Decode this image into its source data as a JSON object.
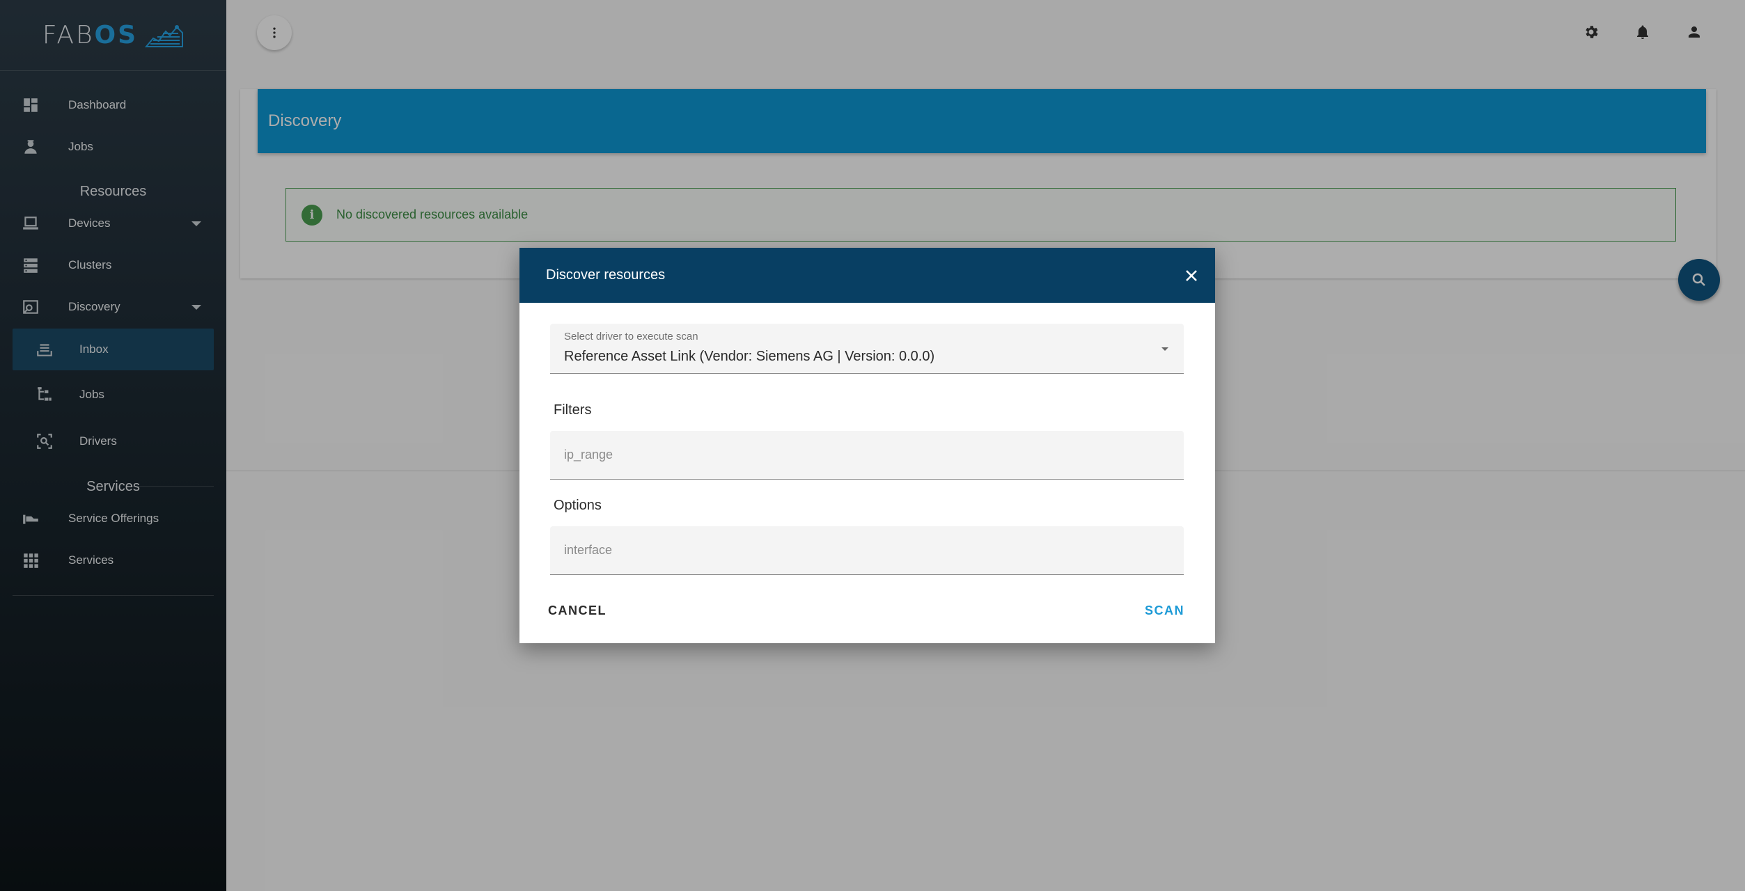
{
  "logo": {
    "part1": "FAB",
    "part2": "OS"
  },
  "sidebar": {
    "items": [
      {
        "label": "Dashboard",
        "icon": "dashboard-icon"
      },
      {
        "label": "Jobs",
        "icon": "worker-icon"
      }
    ],
    "resources_title": "Resources",
    "resources": [
      {
        "label": "Devices",
        "icon": "laptop-icon",
        "expandable": true
      },
      {
        "label": "Clusters",
        "icon": "server-stack-icon"
      },
      {
        "label": "Discovery",
        "icon": "discovery-icon",
        "expandable": true
      }
    ],
    "discovery_sub": [
      {
        "label": "Inbox",
        "icon": "inbox-icon",
        "active": true
      },
      {
        "label": "Jobs",
        "icon": "tree-icon"
      },
      {
        "label": "Drivers",
        "icon": "scan-search-icon"
      }
    ],
    "services_title": "Services",
    "services": [
      {
        "label": "Service Offerings",
        "icon": "offering-icon"
      },
      {
        "label": "Services",
        "icon": "apps-grid-icon"
      }
    ]
  },
  "main": {
    "card_title": "Discovery",
    "alert_text": "No discovered resources available"
  },
  "dialog": {
    "title": "Discover resources",
    "driver_label": "Select driver to execute scan",
    "driver_value": "Reference Asset Link (Vendor: Siemens AG | Version: 0.0.0)",
    "filters_title": "Filters",
    "filters_placeholder": "ip_range",
    "options_title": "Options",
    "options_placeholder": "interface",
    "cancel_label": "CANCEL",
    "scan_label": "SCAN"
  },
  "colors": {
    "header_blue": "#0e98d5",
    "dialog_header": "#083f63",
    "accent": "#1d9ad6",
    "alert_green": "#3d8e45"
  }
}
